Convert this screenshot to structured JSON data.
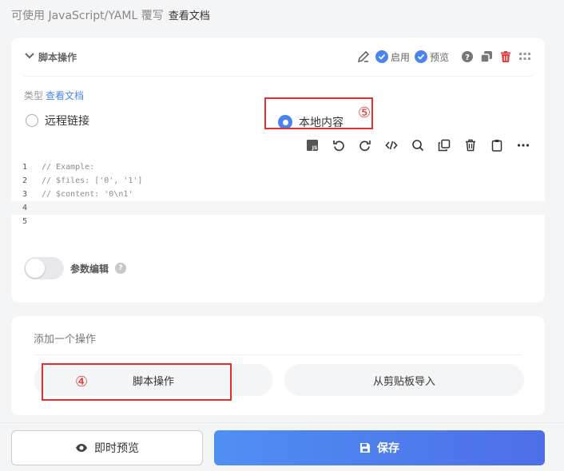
{
  "header": {
    "note": "可使用 JavaScript/YAML 覆写",
    "doc_link": "查看文档"
  },
  "action": {
    "title": "脚本操作",
    "enable_label": "启用",
    "preview_label": "预览",
    "type_label": "类型",
    "type_doc_link": "查看文档",
    "radio_options": [
      "远程链接",
      "本地内容"
    ],
    "selected": "本地内容"
  },
  "editor": {
    "lines": [
      {
        "num": "1",
        "text": "// Example:"
      },
      {
        "num": "2",
        "text": "// $files: ['0', '1']"
      },
      {
        "num": "3",
        "text": "// $content: '0\\n1'"
      },
      {
        "num": "4",
        "text": ""
      },
      {
        "num": "5",
        "text": ""
      }
    ],
    "tool_icons": [
      "js-icon",
      "undo-icon",
      "redo-icon",
      "code-icon",
      "search-icon",
      "copy-icon",
      "trash-icon",
      "clipboard-icon",
      "more-icon"
    ]
  },
  "params": {
    "label": "参数编辑",
    "help": "?"
  },
  "add": {
    "title": "添加一个操作",
    "buttons": [
      "脚本操作",
      "从剪贴板导入"
    ]
  },
  "annotations": {
    "marker4": "④",
    "marker5": "⑤"
  },
  "footer": {
    "preview_label": "即时预览",
    "save_label": "保存"
  },
  "colors": {
    "accent": "#4a84f0",
    "danger": "#e04040",
    "annotation": "#e03030"
  }
}
